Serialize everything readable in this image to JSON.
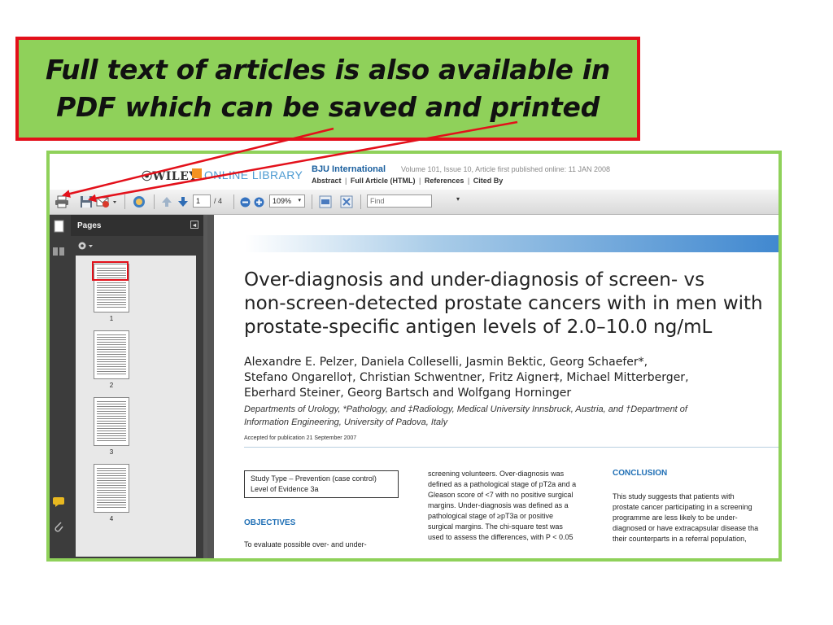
{
  "callout": {
    "line1": "Full text of articles is also available in",
    "line2": "PDF which can be saved and printed"
  },
  "header": {
    "wiley_logo": "WILEY",
    "online_library": "ONLINE LIBRARY",
    "journal": "BJU International",
    "volume_info": "Volume 101, Issue 10, Article first published online: 11 JAN 2008",
    "links": [
      "Abstract",
      "Full Article (HTML)",
      "References",
      "Cited By"
    ]
  },
  "toolbar": {
    "page_current": "1",
    "page_total": "/ 4",
    "zoom": "109%",
    "find_placeholder": "Find",
    "icons": [
      "print-icon",
      "save-icon",
      "email-icon",
      "hand-icon",
      "prev-page-icon",
      "next-page-icon",
      "zoom-out-icon",
      "zoom-in-icon",
      "fit-page-icon",
      "full-screen-icon"
    ]
  },
  "sidebar": {
    "panel_title": "Pages",
    "collapse_symbol": "◂",
    "thumbnails": [
      {
        "label": "1"
      },
      {
        "label": "2"
      },
      {
        "label": "3"
      },
      {
        "label": "4"
      }
    ]
  },
  "article": {
    "title_line1": "Over-diagnosis and under-diagnosis of screen- vs",
    "title_line2": "non-screen-detected prostate cancers with in men with",
    "title_line3": "prostate-specific antigen levels of 2.0–10.0 ng/mL",
    "authors_line1": "Alexandre E. Pelzer, Daniela Colleselli, Jasmin Bektic, Georg Schaefer*,",
    "authors_line2": "Stefano Ongarello†, Christian Schwentner, Fritz Aigner‡, Michael Mitterberger,",
    "authors_line3": "Eberhard Steiner, Georg Bartsch and Wolfgang Horninger",
    "depts_line1": "Departments of Urology, *Pathology, and ‡Radiology, Medical University Innsbruck, Austria, and †Department of",
    "depts_line2": "Information Engineering, University of Padova, Italy",
    "accepted": "Accepted for publication 21 September 2007",
    "study_type": "Study Type – Prevention (case control)",
    "level_of_evidence": "Level of Evidence   3a",
    "objectives_heading": "OBJECTIVES",
    "objectives_text": "To evaluate possible over- and under-",
    "col2_lines": [
      "screening volunteers. Over-diagnosis was",
      "defined as a pathological stage of pT2a and a",
      "Gleason score of <7 with no positive surgical",
      "margins. Under-diagnosis was defined as a",
      "pathological stage of ≥pT3a or positive",
      "surgical margins. The chi-square test was",
      "used to assess the differences, with P < 0.05"
    ],
    "conclusion_heading": "CONCLUSION",
    "col3_lines": [
      "This study suggests that patients with",
      "prostate cancer participating in a screening",
      "programme are less likely to be under-",
      "diagnosed or have extracapsular disease tha",
      "their counterparts in a referral population,"
    ]
  },
  "colors": {
    "callout_bg": "#8fd15a",
    "callout_border": "#e3101a",
    "frame_border": "#8fd15a",
    "heading_blue": "#1f6fb5",
    "arrow_red": "#e3101a"
  }
}
